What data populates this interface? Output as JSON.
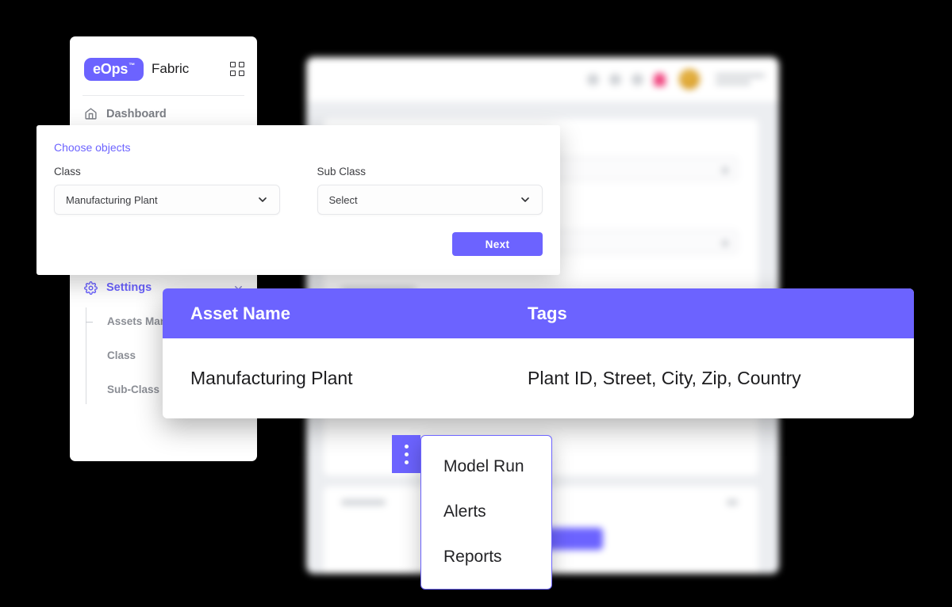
{
  "sidebar": {
    "logo_text": "eOps",
    "logo_tm": "™",
    "brand_word": "Fabric",
    "grid_icon": "grid-apps-icon",
    "nav": [
      {
        "label": "Dashboard",
        "icon": "home-icon"
      }
    ],
    "settings": {
      "label": "Settings",
      "icon": "gear-icon",
      "chevron": "chevron-down-icon",
      "sub_items": [
        {
          "label": "Assets Man"
        },
        {
          "label": "Class"
        },
        {
          "label": "Sub-Class"
        }
      ]
    }
  },
  "dialog": {
    "title": "Choose objects",
    "fields": [
      {
        "label": "Class",
        "value": "Manufacturing Plant",
        "chevron": "chevron-down-icon"
      },
      {
        "label": "Sub Class",
        "value": "Select",
        "chevron": "chevron-down-icon"
      }
    ],
    "next_button": "Next"
  },
  "asset_table": {
    "columns": [
      "Asset Name",
      "Tags"
    ],
    "rows": [
      {
        "asset_name": "Manufacturing Plant",
        "tags": "Plant ID,  Street, City, Zip, Country"
      }
    ]
  },
  "context_menu": {
    "kebab_icon": "kebab-menu-icon",
    "items": [
      "Model Run",
      "Alerts",
      "Reports"
    ]
  },
  "colors": {
    "accent": "#6C63FF",
    "notification_badge": "#f0457f",
    "avatar": "#d79a24",
    "card_bg": "#ffffff",
    "page_bg": "#000000"
  }
}
